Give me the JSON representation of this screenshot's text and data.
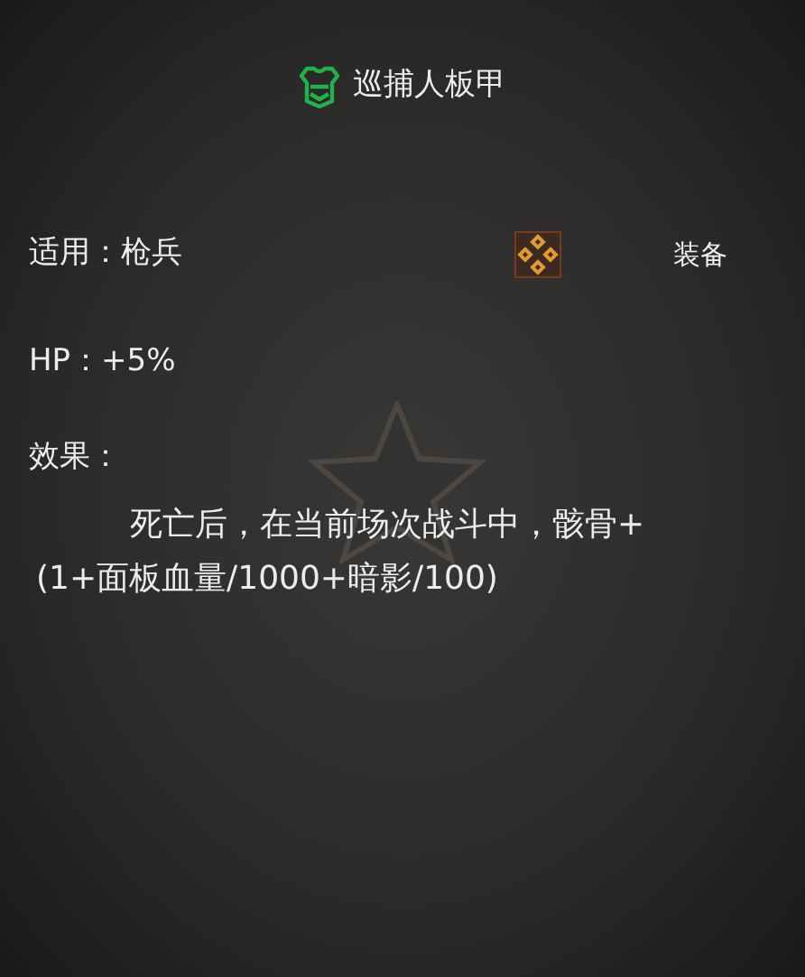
{
  "title": "巡捕人板甲",
  "applicable": "适用：枪兵",
  "equip_button": "装备",
  "hp": "HP：+5%",
  "effect_label": "效果：",
  "effect_text": "死亡后，在当前场次战斗中，骸骨+(1+面板血量/1000+暗影/100)"
}
